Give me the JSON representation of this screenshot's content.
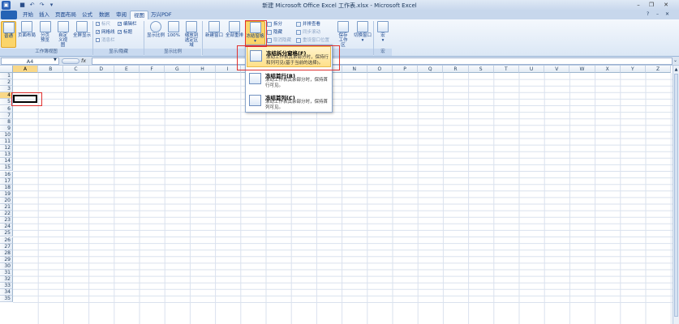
{
  "window": {
    "title": "新建 Microsoft Office Excel 工作表.xlsx - Microsoft Excel",
    "quick_access": [
      "save-icon",
      "undo-icon",
      "redo-icon",
      "customize-icon"
    ],
    "controls": [
      "minimize",
      "restore",
      "close"
    ]
  },
  "tabs": [
    "开始",
    "插入",
    "页面布局",
    "公式",
    "数据",
    "审阅",
    "视图",
    "万兴PDF"
  ],
  "active_tab": "视图",
  "ribbon": {
    "workbook_views": {
      "label": "工作簿视图",
      "buttons": [
        "普通",
        "页面布局",
        "分页预览",
        "自定义视图",
        "全屏显示"
      ]
    },
    "show_hide": {
      "label": "显示/隐藏",
      "items": [
        {
          "label": "标尺",
          "checked": true,
          "enabled": false
        },
        {
          "label": "编辑栏",
          "checked": true,
          "enabled": true
        },
        {
          "label": "网格线",
          "checked": true,
          "enabled": true
        },
        {
          "label": "标题",
          "checked": true,
          "enabled": true
        },
        {
          "label": "消息栏",
          "checked": false,
          "enabled": false
        }
      ]
    },
    "zoom": {
      "label": "显示比例",
      "buttons": [
        "显示比例",
        "100%",
        "缩放到选定区域"
      ]
    },
    "window_group": {
      "buttons": [
        "新建窗口",
        "全部重排",
        "冻结窗格"
      ],
      "small": [
        "拆分",
        "隐藏",
        "取消隐藏",
        "并排查看",
        "同步滚动",
        "重设窗口位置"
      ],
      "big2": [
        "保存工作区",
        "切换窗口"
      ]
    },
    "macro": {
      "label": "宏",
      "button": "宏"
    }
  },
  "formula_bar": {
    "name_box": "A4",
    "fx": "fx",
    "value": ""
  },
  "columns": [
    "A",
    "B",
    "C",
    "D",
    "E",
    "F",
    "G",
    "H",
    "I",
    "J",
    "K",
    "L",
    "M",
    "N",
    "O",
    "P",
    "Q",
    "R",
    "S",
    "T",
    "U",
    "V",
    "W",
    "X",
    "Y",
    "Z"
  ],
  "rows": [
    "1",
    "2",
    "3",
    "4",
    "5",
    "6",
    "7",
    "8",
    "9",
    "10",
    "11",
    "12",
    "13",
    "14",
    "15",
    "16",
    "17",
    "18",
    "19",
    "20",
    "21",
    "22",
    "23",
    "24",
    "25",
    "26",
    "27",
    "28",
    "29",
    "30",
    "31",
    "32",
    "33",
    "34",
    "35"
  ],
  "selected_cell": "A4",
  "freeze_menu": [
    {
      "title": "冻结拆分窗格(F)",
      "desc": "滚动工作表其余部分时，保持行和列可见(基于当前的选择)。"
    },
    {
      "title": "冻结首行(R)",
      "desc": "滚动工作表其余部分时，保持首行可见。"
    },
    {
      "title": "冻结首列(C)",
      "desc": "滚动工作表其余部分时，保持首列可见。"
    }
  ]
}
